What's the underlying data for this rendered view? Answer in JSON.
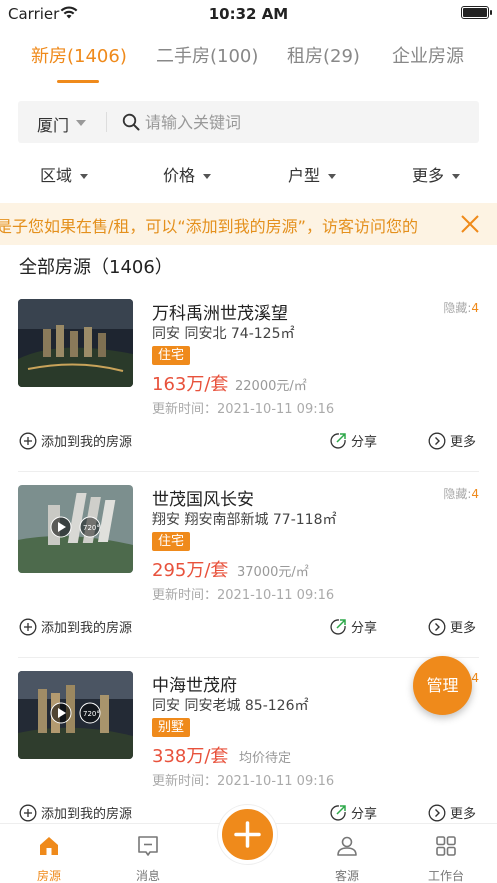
{
  "status_bar": {
    "carrier": "Carrier",
    "time": "10:32 AM"
  },
  "tabs": [
    {
      "label": "新房(1406)",
      "active": true
    },
    {
      "label": "二手房(100)",
      "active": false
    },
    {
      "label": "租房(29)",
      "active": false
    },
    {
      "label": "企业房源",
      "active": false
    }
  ],
  "search": {
    "city": "厦门",
    "placeholder": "请输入关键词"
  },
  "filters": [
    "区域",
    "价格",
    "户型",
    "更多"
  ],
  "notice": {
    "text": "是子您如果在售/租，可以“添加到我的房源”，访客访问您的"
  },
  "section": {
    "title": "全部房源（1406）"
  },
  "listings": [
    {
      "name": "万科禹洲世茂溪望",
      "area": "同安  同安北 74-125㎡",
      "tag": "住宅",
      "price": "163万/套",
      "unit_price": "22000元/㎡",
      "updated": "更新时间：2021-10-11 09:16",
      "hidden_label": "隐藏:",
      "hidden_count": "4"
    },
    {
      "name": "世茂国风长安",
      "area": "翔安  翔安南部新城 77-118㎡",
      "tag": "住宅",
      "price": "295万/套",
      "unit_price": "37000元/㎡",
      "updated": "更新时间：2021-10-11 09:16",
      "hidden_label": "隐藏:",
      "hidden_count": "4"
    },
    {
      "name": "中海世茂府",
      "area": "同安  同安老城 85-126㎡",
      "tag": "别墅",
      "price": "338万/套",
      "unit_price": "均价待定",
      "updated": "更新时间：2021-10-11 09:16",
      "hidden_label": "",
      "hidden_count": "4"
    }
  ],
  "actions": {
    "add": "添加到我的房源",
    "share": "分享",
    "more": "更多"
  },
  "manage_button": "管理",
  "bottom_nav": [
    {
      "label": "房源",
      "icon": "home-icon",
      "active": true
    },
    {
      "label": "消息",
      "icon": "message-icon",
      "active": false
    },
    {
      "label": "客源",
      "icon": "user-icon",
      "active": false
    },
    {
      "label": "工作台",
      "icon": "grid-icon",
      "active": false
    }
  ],
  "colors": {
    "accent": "#ef8a1b",
    "price": "#e8523c",
    "notice_bg": "#fdf3e3"
  }
}
